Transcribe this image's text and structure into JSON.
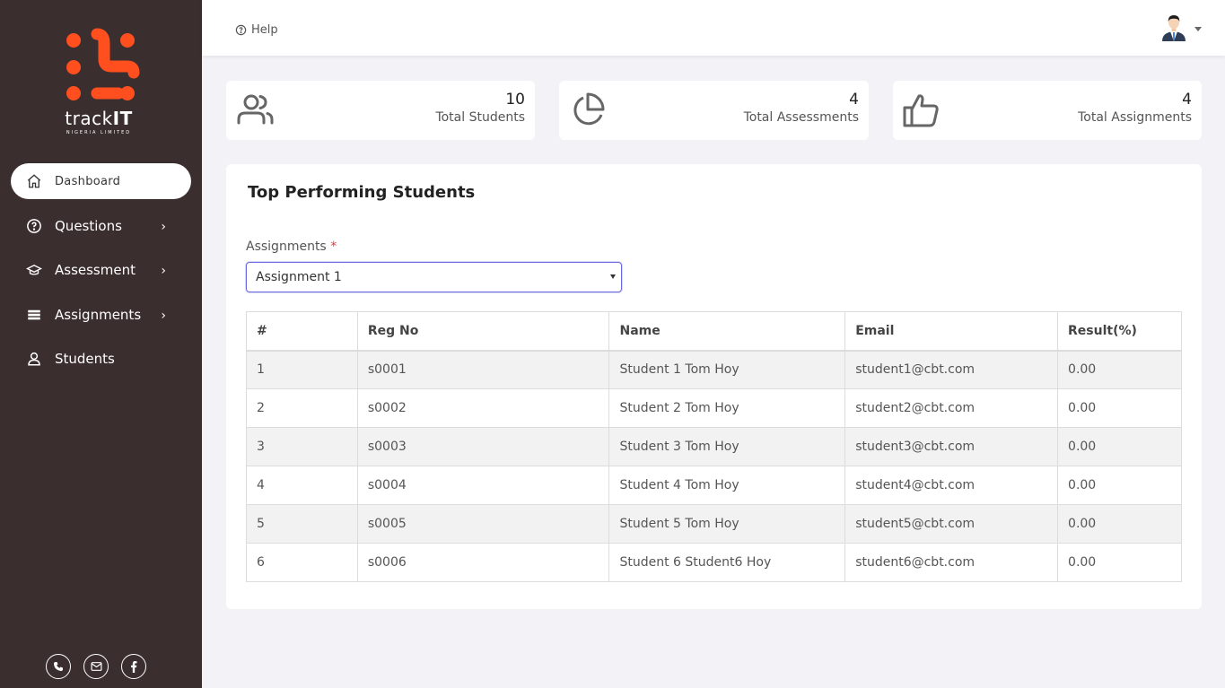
{
  "logo": {
    "text_light": "track",
    "text_bold": "IT",
    "subtitle": "NIGERIA LIMITED"
  },
  "sidebar": {
    "items": [
      {
        "label": "Dashboard",
        "icon": "home-icon",
        "active": true
      },
      {
        "label": "Questions",
        "icon": "question-circle-icon",
        "has_submenu": true
      },
      {
        "label": "Assessment",
        "icon": "graduation-cap-icon",
        "has_submenu": true
      },
      {
        "label": "Assignments",
        "icon": "stack-icon",
        "has_submenu": true
      },
      {
        "label": "Students",
        "icon": "users-icon"
      }
    ],
    "social": [
      "phone-icon",
      "mail-icon",
      "facebook-icon"
    ]
  },
  "topbar": {
    "help_label": "Help",
    "avatar_icon": "user-avatar-icon"
  },
  "stats": [
    {
      "value": "10",
      "label": "Total Students",
      "icon": "users-outline-icon"
    },
    {
      "value": "4",
      "label": "Total Assessments",
      "icon": "pie-chart-icon"
    },
    {
      "value": "4",
      "label": "Total Assignments",
      "icon": "thumbs-up-icon"
    }
  ],
  "panel": {
    "title": "Top Performing Students",
    "field_label": "Assignments",
    "required_mark": "*",
    "selected": "Assignment 1"
  },
  "table": {
    "columns": [
      "#",
      "Reg No",
      "Name",
      "Email",
      "Result(%)"
    ],
    "rows": [
      [
        "1",
        "s0001",
        "Student 1 Tom Hoy",
        "student1@cbt.com",
        "0.00"
      ],
      [
        "2",
        "s0002",
        "Student 2 Tom Hoy",
        "student2@cbt.com",
        "0.00"
      ],
      [
        "3",
        "s0003",
        "Student 3 Tom Hoy",
        "student3@cbt.com",
        "0.00"
      ],
      [
        "4",
        "s0004",
        "Student 4 Tom Hoy",
        "student4@cbt.com",
        "0.00"
      ],
      [
        "5",
        "s0005",
        "Student 5 Tom Hoy",
        "student5@cbt.com",
        "0.00"
      ],
      [
        "6",
        "s0006",
        "Student 6 Student6 Hoy",
        "student6@cbt.com",
        "0.00"
      ]
    ]
  },
  "colors": {
    "sidebar_bg": "#3b2e2e",
    "brand_orange": "#ff4f1f",
    "focus_border": "#6c6ae0"
  }
}
